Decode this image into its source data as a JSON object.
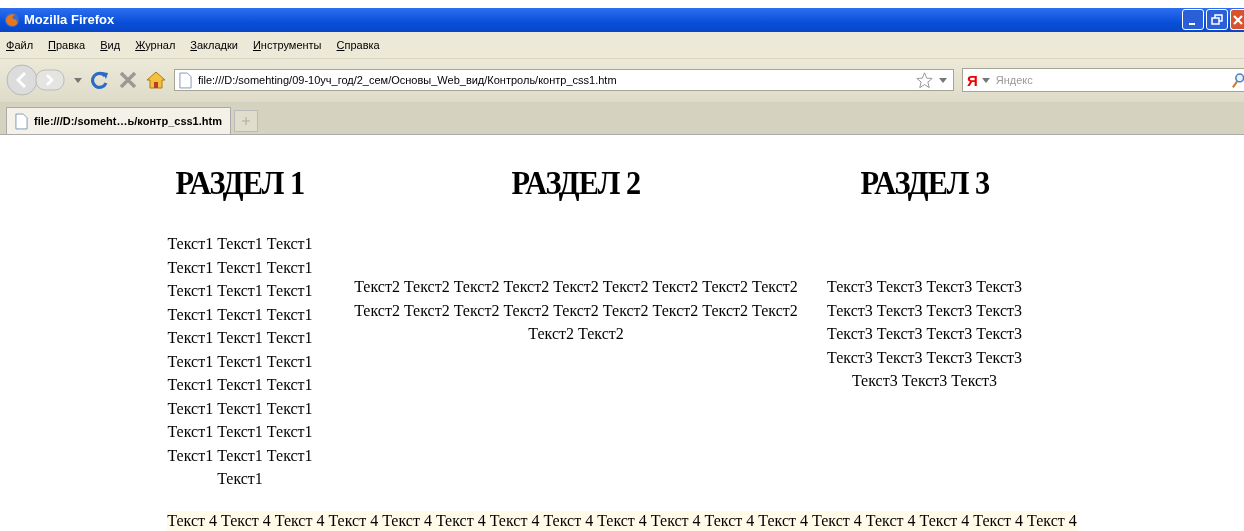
{
  "window": {
    "title": "Mozilla Firefox"
  },
  "menu": [
    "Файл",
    "Правка",
    "Вид",
    "Журнал",
    "Закладки",
    "Инструменты",
    "Справка"
  ],
  "address": {
    "value": "file:///D:/somehting/09-10уч_год/2_сем/Основы_Web_вид/Контроль/контр_css1.htm"
  },
  "search": {
    "engine_logo": "Я",
    "placeholder": "Яндекс"
  },
  "tabs": [
    {
      "label": "file:///D:/someht…ь/контр_css1.htm",
      "selected": true
    }
  ],
  "page": {
    "sections": [
      {
        "heading": "РАЗДЕЛ 1",
        "text": "Текст1 Текст1 Текст1 Текст1 Текст1 Текст1 Текст1 Текст1 Текст1 Текст1 Текст1 Текст1 Текст1 Текст1 Текст1 Текст1 Текст1 Текст1 Текст1 Текст1 Текст1 Текст1 Текст1 Текст1 Текст1 Текст1 Текст1 Текст1 Текст1 Текст1 Текст1"
      },
      {
        "heading": "РАЗДЕЛ 2",
        "text": "Текст2 Текст2 Текст2 Текст2 Текст2 Текст2 Текст2 Текст2 Текст2 Текст2 Текст2 Текст2 Текст2 Текст2 Текст2 Текст2 Текст2 Текст2 Текст2 Текст2"
      },
      {
        "heading": "РАЗДЕЛ 3",
        "text": "Текст3 Текст3 Текст3 Текст3 Текст3 Текст3 Текст3 Текст3 Текст3 Текст3 Текст3 Текст3 Текст3 Текст3 Текст3 Текст3 Текст3 Текст3 Текст3"
      }
    ],
    "footer_text": "Текст 4 Текст 4 Текст 4 Текст 4 Текст 4 Текст 4 Текст 4 Текст 4 Текст 4 Текст 4 Текст 4 Текст 4 Текст 4 Текст 4 Текст 4 Текст 4 Текст 4"
  }
}
